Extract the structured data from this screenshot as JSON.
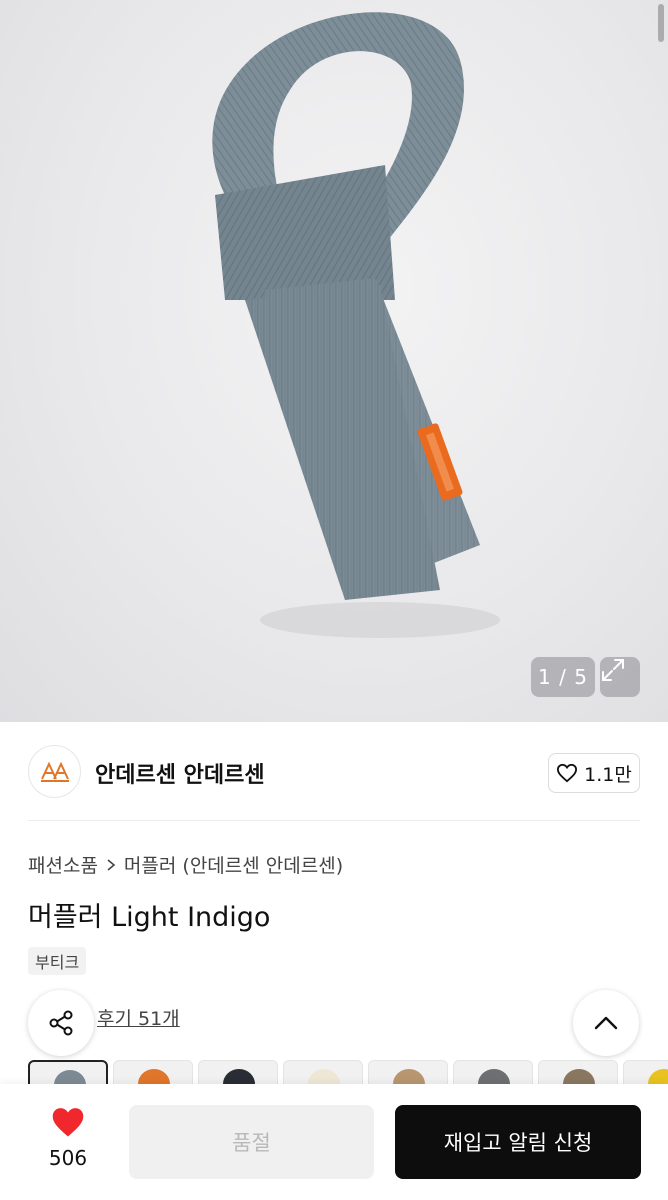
{
  "hero": {
    "image": "scarf-product-photo",
    "pager": "1 / 5"
  },
  "brand": {
    "name": "안데르센 안데르센",
    "logo_icon": "brand-logo-icon",
    "likes": "1.1만"
  },
  "breadcrumb": {
    "category": "패션소품",
    "subcategory": "머플러 (안데르센 안데르센)"
  },
  "product": {
    "title": "머플러 Light Indigo",
    "badge": "부티크"
  },
  "reviews": {
    "label": "후기 51개"
  },
  "swatches": [
    {
      "color": "#7e8a93",
      "selected": true
    },
    {
      "color": "#e0762a",
      "selected": false
    },
    {
      "color": "#2a2d36",
      "selected": false
    },
    {
      "color": "#efe7d6",
      "selected": false
    },
    {
      "color": "#b89770",
      "selected": false
    },
    {
      "color": "#6d6f72",
      "selected": false
    },
    {
      "color": "#8a7760",
      "selected": false
    },
    {
      "color": "#e8c320",
      "selected": false
    }
  ],
  "bottom": {
    "wish_count": "506",
    "soldout_label": "품절",
    "restock_label": "재입고 알림 신청"
  },
  "colors": {
    "heart": "#f0282d",
    "cta": "#0d0d0d",
    "scarf": "#7f909b"
  }
}
